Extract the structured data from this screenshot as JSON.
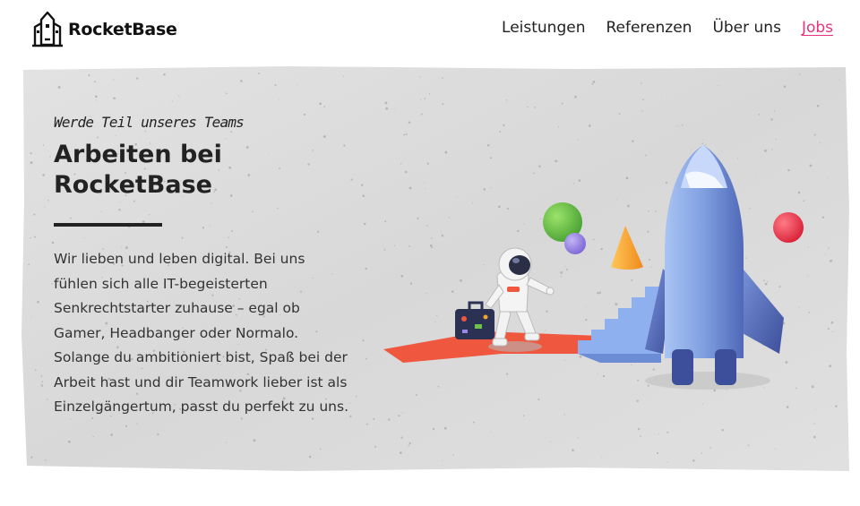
{
  "brand": {
    "name": "RocketBase",
    "logo_icon": "rocket-building-icon"
  },
  "nav": {
    "items": [
      {
        "label": "Leistungen",
        "active": false
      },
      {
        "label": "Referenzen",
        "active": false
      },
      {
        "label": "Über uns",
        "active": false
      },
      {
        "label": "Jobs",
        "active": true
      }
    ],
    "active_color": "#e5337d"
  },
  "hero": {
    "eyebrow": "Werde Teil unseres Teams",
    "title": "Arbeiten bei RocketBase",
    "body": "Wir lieben und leben digital. Bei uns fühlen sich alle IT-begeisterten Senkrechtstarter zuhause – egal ob Gamer, Headbanger oder Normalo. Solange du ambitioniert bist, Spaß bei der Arbeit hast und dir Teamwork lieber ist als Einzelgängertum, passt du perfekt zu uns.",
    "illustration": "astronaut-walking-to-rocket-illustration"
  },
  "colors": {
    "concrete": "#dcdcdc",
    "rocket": "#7f9fe0",
    "carpet": "#f0573f",
    "green_ball": "#6cc24a",
    "purple_ball": "#9b87e6",
    "orange_cone": "#f7a531",
    "red_ball": "#e8364a"
  }
}
